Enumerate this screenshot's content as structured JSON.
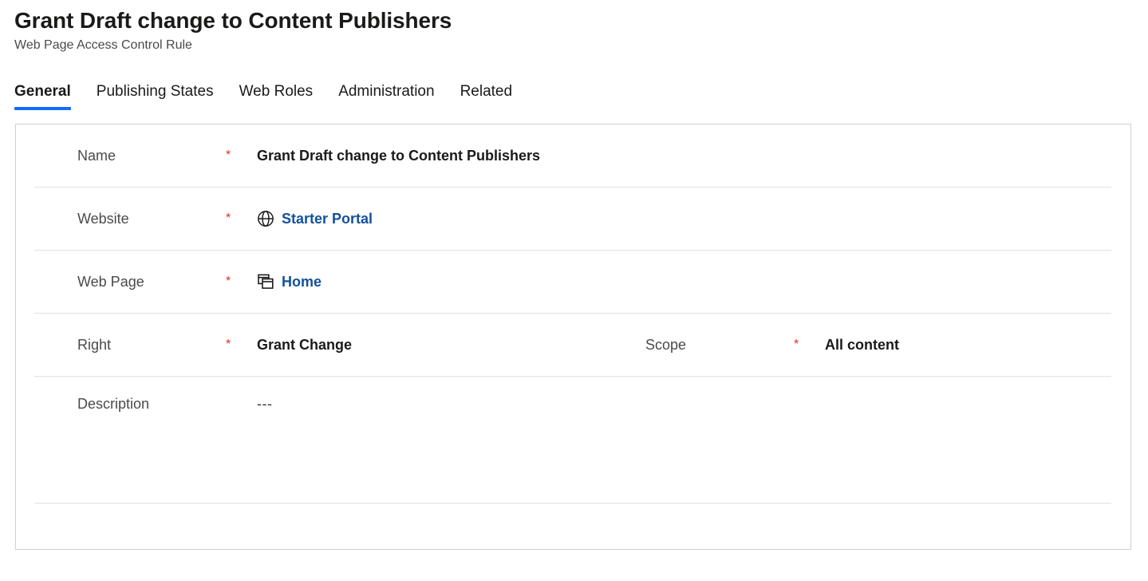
{
  "header": {
    "title": "Grant Draft change to Content Publishers",
    "subtitle": "Web Page Access Control Rule"
  },
  "tabs": [
    {
      "label": "General",
      "selected": true
    },
    {
      "label": "Publishing States",
      "selected": false
    },
    {
      "label": "Web Roles",
      "selected": false
    },
    {
      "label": "Administration",
      "selected": false
    },
    {
      "label": "Related",
      "selected": false
    }
  ],
  "form": {
    "rows": [
      {
        "fields": [
          {
            "label": "Name",
            "required": true,
            "required_mark": "*",
            "value": "Grant Draft change to Content Publishers",
            "icon": null,
            "is_link": false
          }
        ]
      },
      {
        "fields": [
          {
            "label": "Website",
            "required": true,
            "required_mark": "*",
            "value": "Starter Portal",
            "icon": "globe-icon",
            "is_link": true
          }
        ]
      },
      {
        "fields": [
          {
            "label": "Web Page",
            "required": true,
            "required_mark": "*",
            "value": "Home",
            "icon": "web-pages-icon",
            "is_link": true
          }
        ]
      },
      {
        "fields": [
          {
            "label": "Right",
            "required": true,
            "required_mark": "*",
            "value": "Grant Change",
            "icon": null,
            "is_link": false
          },
          {
            "label": "Scope",
            "required": true,
            "required_mark": "*",
            "value": "All content",
            "icon": null,
            "is_link": false
          }
        ]
      },
      {
        "fields": [
          {
            "label": "Description",
            "required": false,
            "required_mark": "",
            "value": "---",
            "icon": null,
            "is_link": false
          }
        ]
      }
    ]
  },
  "colors": {
    "accent": "#0f6cff",
    "link": "#12509c",
    "required": "#d93025",
    "label": "#4a4a4a",
    "border": "#cfcfcf",
    "divider": "#e1e1e1"
  }
}
